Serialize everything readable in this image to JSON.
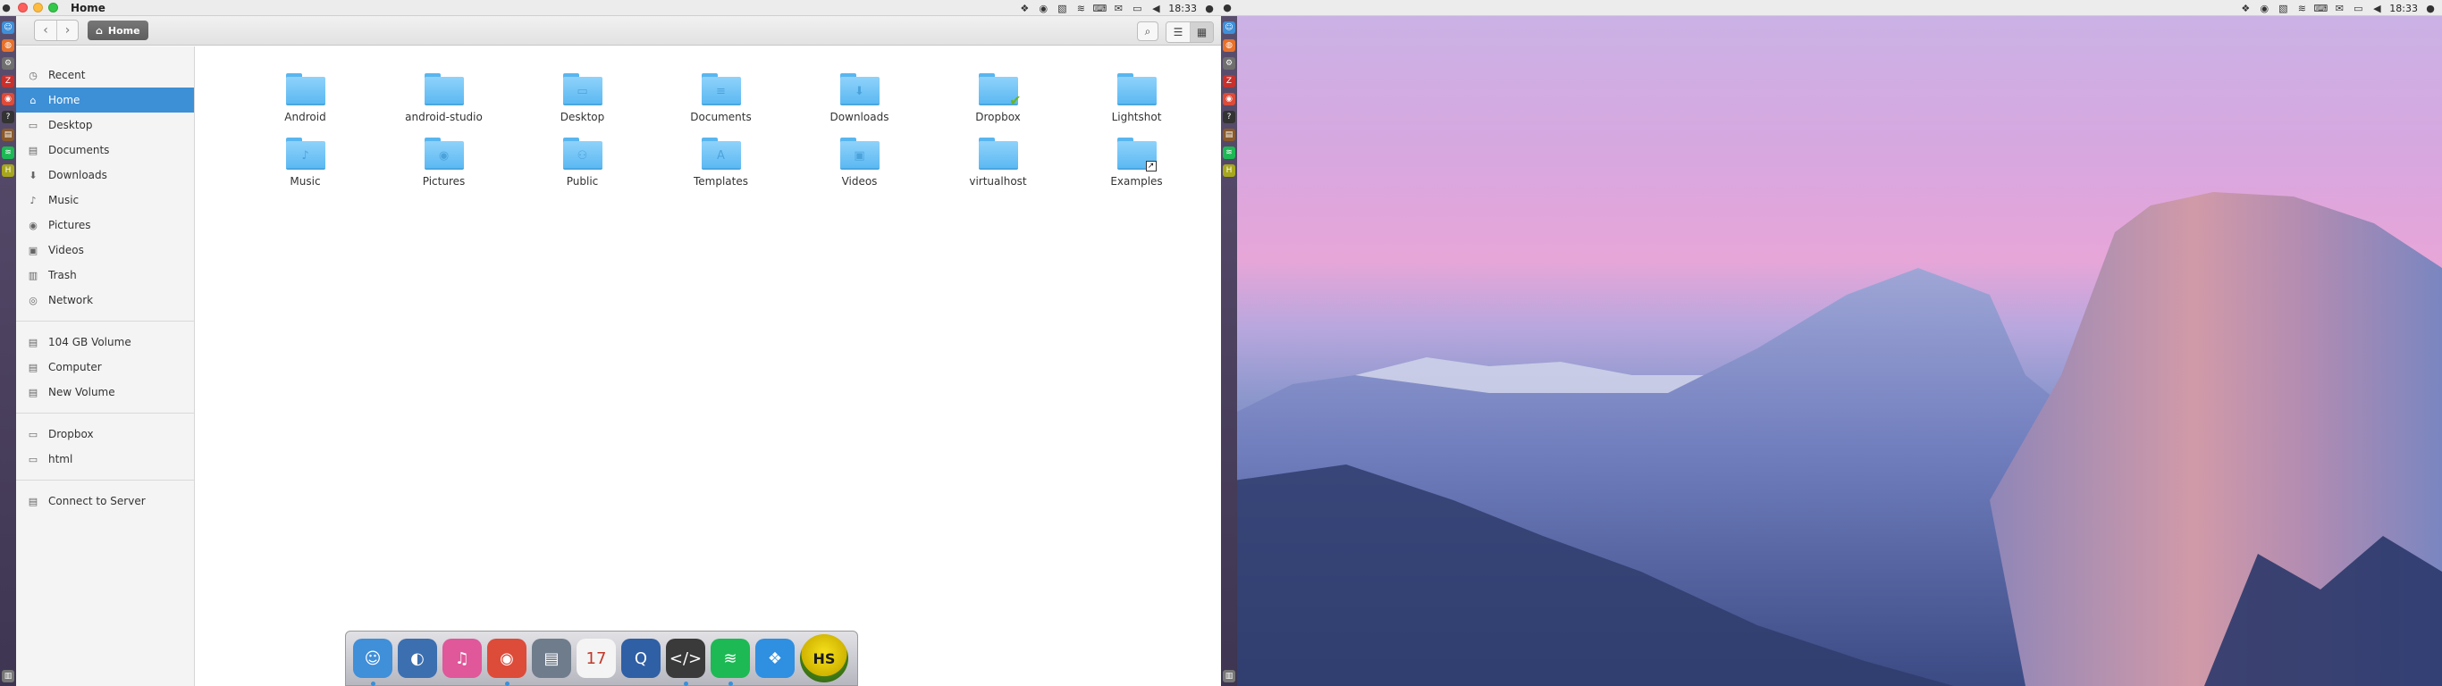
{
  "left_screen": {
    "panel": {
      "window_title": "Home",
      "time": "18:33"
    },
    "toolbar": {
      "path_label": "Home"
    },
    "sidebar": {
      "places": [
        {
          "label": "Recent",
          "icon": "clock-icon"
        },
        {
          "label": "Home",
          "icon": "home-icon",
          "active": true
        },
        {
          "label": "Desktop",
          "icon": "desktop-icon"
        },
        {
          "label": "Documents",
          "icon": "document-icon"
        },
        {
          "label": "Downloads",
          "icon": "download-icon"
        },
        {
          "label": "Music",
          "icon": "music-icon"
        },
        {
          "label": "Pictures",
          "icon": "camera-icon"
        },
        {
          "label": "Videos",
          "icon": "film-icon"
        },
        {
          "label": "Trash",
          "icon": "trash-icon"
        },
        {
          "label": "Network",
          "icon": "network-icon"
        }
      ],
      "devices": [
        {
          "label": "104 GB Volume",
          "icon": "drive-icon"
        },
        {
          "label": "Computer",
          "icon": "drive-icon"
        },
        {
          "label": "New Volume",
          "icon": "drive-icon"
        }
      ],
      "bookmarks": [
        {
          "label": "Dropbox",
          "icon": "folder-icon"
        },
        {
          "label": "html",
          "icon": "folder-icon"
        }
      ],
      "connect": {
        "label": "Connect to Server",
        "icon": "server-icon"
      }
    },
    "files": [
      {
        "name": "Android",
        "emblem": ""
      },
      {
        "name": "android-studio",
        "emblem": ""
      },
      {
        "name": "Desktop",
        "emblem": "▭"
      },
      {
        "name": "Documents",
        "emblem": "≡"
      },
      {
        "name": "Downloads",
        "emblem": "⬇"
      },
      {
        "name": "Dropbox",
        "emblem": "",
        "badge": "✔"
      },
      {
        "name": "Lightshot",
        "emblem": ""
      },
      {
        "name": "Music",
        "emblem": "♪"
      },
      {
        "name": "Pictures",
        "emblem": "◉"
      },
      {
        "name": "Public",
        "emblem": "⚇"
      },
      {
        "name": "Templates",
        "emblem": "A"
      },
      {
        "name": "Videos",
        "emblem": "▣"
      },
      {
        "name": "virtualhost",
        "emblem": ""
      },
      {
        "name": "Examples",
        "emblem": "",
        "link": "↗"
      }
    ],
    "dock": {
      "items": [
        {
          "name": "finder",
          "glyph": "☺",
          "color": "#3f8fd9",
          "running": true
        },
        {
          "name": "browser",
          "glyph": "◐",
          "color": "#3b6fb0",
          "running": false
        },
        {
          "name": "itunes",
          "glyph": "♫",
          "color": "#e0579a",
          "running": false
        },
        {
          "name": "chrome",
          "glyph": "◉",
          "color": "#dd4b39",
          "running": true
        },
        {
          "name": "scanner",
          "glyph": "▤",
          "color": "#6f7c8c",
          "running": false
        },
        {
          "name": "calendar",
          "glyph": "17",
          "color": "#f4f4f4",
          "running": false
        },
        {
          "name": "quicktime",
          "glyph": "Q",
          "color": "#2f5fa5",
          "running": false
        },
        {
          "name": "code-editor",
          "glyph": "</>",
          "color": "#3a3a3a",
          "running": true
        },
        {
          "name": "spotify",
          "glyph": "≋",
          "color": "#1db954",
          "running": true
        },
        {
          "name": "dropbox",
          "glyph": "❖",
          "color": "#2f8fe0",
          "running": false
        }
      ],
      "hs_label": "HS"
    }
  },
  "right_screen": {
    "panel": {
      "time": "18:33"
    }
  }
}
